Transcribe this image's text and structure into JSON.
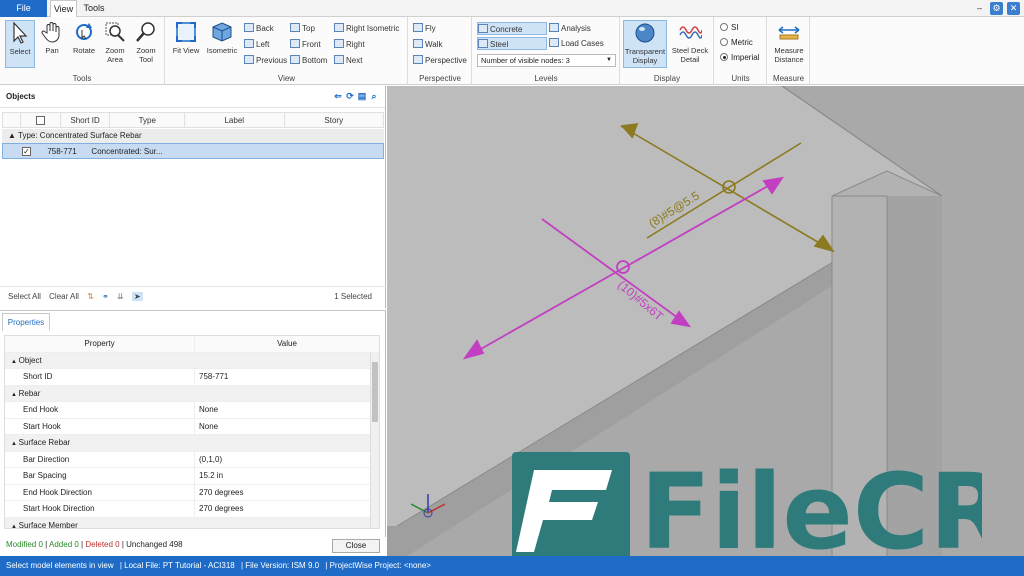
{
  "tabs": {
    "file": "File",
    "view": "View",
    "tools": "Tools"
  },
  "window_controls": [
    "–",
    "⚙",
    "✕"
  ],
  "ribbon": {
    "tools_group": {
      "label": "Tools",
      "buttons": [
        "Select",
        "Pan",
        "Rotate",
        "Zoom Area",
        "Zoom Tool"
      ]
    },
    "view_group": {
      "label": "View",
      "fit_view": "Fit View",
      "isometric": "Isometric",
      "small": [
        "Back",
        "Left",
        "Previous",
        "Top",
        "Front",
        "Bottom",
        "Right Isometric",
        "Right",
        "Next"
      ]
    },
    "perspective_group": {
      "label": "Perspective",
      "items": [
        "Fly",
        "Walk",
        "Perspective"
      ]
    },
    "levels_group": {
      "label": "Levels",
      "concrete": "Concrete",
      "steel": "Steel",
      "analysis": "Analysis",
      "load_cases": "Load Cases",
      "nodes_dropdown": "Number of visible nodes: 3"
    },
    "display_group": {
      "label": "Display",
      "transparent": "Transparent Display",
      "steel_deck": "Steel Deck Detail"
    },
    "units_group": {
      "label": "Units",
      "options": [
        "SI",
        "Metric",
        "Imperial"
      ],
      "selected": "Imperial"
    },
    "measure_group": {
      "label": "Measure",
      "button": "Measure Distance"
    }
  },
  "objects_panel": {
    "title": "Objects",
    "columns": [
      "Short ID",
      "Type",
      "Label",
      "Story"
    ],
    "group_row": "Type: Concentrated Surface Rebar",
    "selected_row": {
      "short_id": "758-771",
      "type": "Concentrated: Sur...",
      "label": "",
      "story": ""
    },
    "footer": {
      "select_all": "Select All",
      "clear_all": "Clear All",
      "count": "1 Selected"
    }
  },
  "properties_panel": {
    "tab": "Properties",
    "columns": {
      "property": "Property",
      "value": "Value"
    },
    "rows": [
      {
        "cat": true,
        "k": "Object",
        "v": ""
      },
      {
        "cat": false,
        "k": "Short ID",
        "v": "758-771"
      },
      {
        "cat": true,
        "k": "Rebar",
        "v": ""
      },
      {
        "cat": false,
        "k": "End Hook",
        "v": "None"
      },
      {
        "cat": false,
        "k": "Start Hook",
        "v": "None"
      },
      {
        "cat": true,
        "k": "Surface Rebar",
        "v": ""
      },
      {
        "cat": false,
        "k": "Bar Direction",
        "v": "(0,1,0)"
      },
      {
        "cat": false,
        "k": "Bar Spacing",
        "v": "15.2 in"
      },
      {
        "cat": false,
        "k": "End Hook Direction",
        "v": "270 degrees"
      },
      {
        "cat": false,
        "k": "Start Hook Direction",
        "v": "270 degrees"
      },
      {
        "cat": true,
        "k": "Surface Member",
        "v": ""
      }
    ],
    "status": {
      "modified": "Modified 0",
      "added": "Added 0",
      "deleted": "Deleted 0",
      "unchanged": "Unchanged 498"
    },
    "close": "Close"
  },
  "viewport": {
    "label_gold": "(8)#5@5.5",
    "label_magenta": "(10)#5x6T",
    "colors": {
      "gold": "#8b7a1f",
      "magenta": "#c23fc2",
      "slab": "#b5b5b5"
    }
  },
  "watermark": "FileCR",
  "statusbar": {
    "hint": "Select model elements in view",
    "local_file": "Local File: PT Tutorial - ACI318",
    "file_version": "File Version: ISM 9.0",
    "project": "ProjectWise Project: <none>"
  }
}
